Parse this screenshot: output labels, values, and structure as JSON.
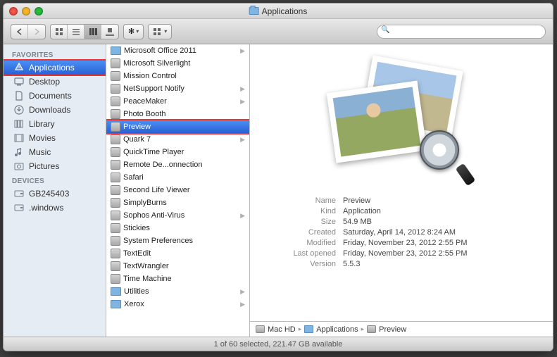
{
  "window": {
    "title": "Applications"
  },
  "toolbar": {
    "search_placeholder": ""
  },
  "sidebar": {
    "sections": [
      {
        "header": "FAVORITES",
        "items": [
          {
            "name": "Applications",
            "icon": "A",
            "selected": true
          },
          {
            "name": "Desktop",
            "icon": "desktop"
          },
          {
            "name": "Documents",
            "icon": "doc"
          },
          {
            "name": "Downloads",
            "icon": "down"
          },
          {
            "name": "Library",
            "icon": "lib"
          },
          {
            "name": "Movies",
            "icon": "mov"
          },
          {
            "name": "Music",
            "icon": "mus"
          },
          {
            "name": "Pictures",
            "icon": "pic"
          }
        ]
      },
      {
        "header": "DEVICES",
        "items": [
          {
            "name": "GB245403",
            "icon": "disk"
          },
          {
            "name": ".windows",
            "icon": "disk"
          }
        ]
      }
    ]
  },
  "list": [
    {
      "name": "Microsoft Office 2011",
      "icon": "folder",
      "arrow": true
    },
    {
      "name": "Microsoft Silverlight",
      "icon": "generic"
    },
    {
      "name": "Mission Control",
      "icon": "generic"
    },
    {
      "name": "NetSupport Notify",
      "icon": "generic",
      "arrow": true
    },
    {
      "name": "PeaceMaker",
      "icon": "generic",
      "arrow": true
    },
    {
      "name": "Photo Booth",
      "icon": "generic"
    },
    {
      "name": "Preview",
      "icon": "generic",
      "selected": true
    },
    {
      "name": "Quark 7",
      "icon": "generic",
      "arrow": true
    },
    {
      "name": "QuickTime Player",
      "icon": "generic"
    },
    {
      "name": "Remote De...onnection",
      "icon": "generic"
    },
    {
      "name": "Safari",
      "icon": "generic"
    },
    {
      "name": "Second Life Viewer",
      "icon": "generic"
    },
    {
      "name": "SimplyBurns",
      "icon": "generic"
    },
    {
      "name": "Sophos Anti-Virus",
      "icon": "generic",
      "arrow": true
    },
    {
      "name": "Stickies",
      "icon": "generic"
    },
    {
      "name": "System Preferences",
      "icon": "generic"
    },
    {
      "name": "TextEdit",
      "icon": "generic"
    },
    {
      "name": "TextWrangler",
      "icon": "generic"
    },
    {
      "name": "Time Machine",
      "icon": "generic"
    },
    {
      "name": "Utilities",
      "icon": "folder",
      "arrow": true
    },
    {
      "name": "Xerox",
      "icon": "folder",
      "arrow": true
    }
  ],
  "detail": {
    "labels": {
      "name": "Name",
      "kind": "Kind",
      "size": "Size",
      "created": "Created",
      "modified": "Modified",
      "last_opened": "Last opened",
      "version": "Version"
    },
    "values": {
      "name": "Preview",
      "kind": "Application",
      "size": "54.9 MB",
      "created": "Saturday, April 14, 2012 8:24 AM",
      "modified": "Friday, November 23, 2012 2:55 PM",
      "last_opened": "Friday, November 23, 2012 2:55 PM",
      "version": "5.5.3"
    }
  },
  "path": [
    {
      "name": "Mac HD",
      "icon": "disk"
    },
    {
      "name": "Applications",
      "icon": "folder"
    },
    {
      "name": "Preview",
      "icon": "generic"
    }
  ],
  "status": "1 of 60 selected, 221.47 GB available"
}
